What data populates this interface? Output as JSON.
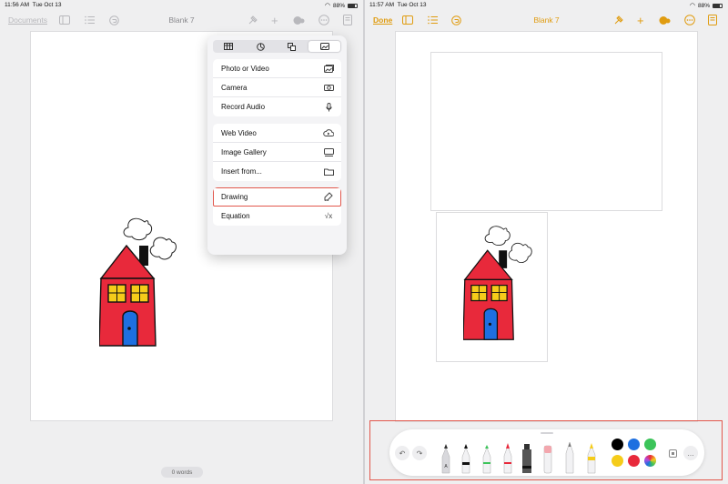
{
  "left": {
    "status": {
      "time": "11:56 AM",
      "date": "Tue Oct 13",
      "battery": "88%"
    },
    "toolbar": {
      "documents": "Documents",
      "title": "Blank 7"
    },
    "insert_menu": {
      "tabs": [
        "table-icon",
        "chart-icon",
        "shapes-icon",
        "media-icon"
      ],
      "groups": [
        [
          {
            "label": "Photo or Video",
            "icon": "photo-icon"
          },
          {
            "label": "Camera",
            "icon": "camera-icon"
          },
          {
            "label": "Record Audio",
            "icon": "mic-icon"
          }
        ],
        [
          {
            "label": "Web Video",
            "icon": "cloud-play-icon"
          },
          {
            "label": "Image Gallery",
            "icon": "gallery-icon"
          },
          {
            "label": "Insert from...",
            "icon": "folder-icon"
          }
        ],
        [
          {
            "label": "Drawing",
            "icon": "pen-scribble-icon"
          },
          {
            "label": "Equation",
            "icon": "sqrt-icon"
          }
        ]
      ],
      "highlighted": "Drawing"
    },
    "word_count": "0 words"
  },
  "right": {
    "status": {
      "time": "11:57 AM",
      "date": "Tue Oct 13",
      "battery": "88%"
    },
    "toolbar": {
      "done": "Done",
      "title": "Blank 7"
    },
    "palette": {
      "tools": [
        "pen-a",
        "pen",
        "marker-green",
        "marker-red",
        "fill",
        "eraser",
        "pencil",
        "crayon"
      ],
      "colors": [
        "#000000",
        "#1e6fe0",
        "#3cc45a",
        "#f5cc1a",
        "#e8293b",
        "color-wheel"
      ]
    }
  },
  "colors": {
    "accent": "#e09c10",
    "highlight": "#e2574c",
    "house": "#e8293b",
    "door": "#1e6fe0",
    "window": "#f5cc1a"
  }
}
